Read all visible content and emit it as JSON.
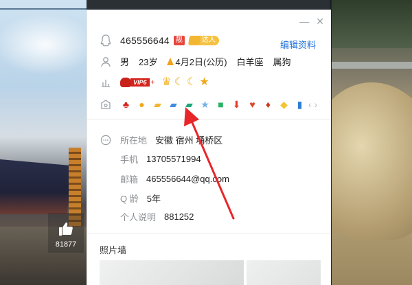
{
  "profile": {
    "qq_number": "465556644",
    "liang_badge": "靓",
    "daren_badge": "达人",
    "edit_link": "编辑资料",
    "gender": "男",
    "age": "23岁",
    "birthday": "4月2日(公历)",
    "constellation": "白羊座",
    "zodiac": "属狗",
    "vip_label": "VIP6",
    "level_icons": [
      "crown-icon",
      "moon-icon",
      "moon-icon",
      "star-icon"
    ]
  },
  "medals": [
    {
      "icon": "penguin-medal-icon",
      "color": "#d3231b"
    },
    {
      "icon": "qq-show-medal-icon",
      "color": "#f0a81a"
    },
    {
      "icon": "chat-medal-icon",
      "color": "#f2b632"
    },
    {
      "icon": "blue-chat-medal-icon",
      "color": "#3f8ee0"
    },
    {
      "icon": "green-chat-medal-icon",
      "color": "#1ea57a"
    },
    {
      "icon": "star-medal-icon",
      "color": "#6fb2e6"
    },
    {
      "icon": "gift-medal-icon",
      "color": "#28b463"
    },
    {
      "icon": "down-arrow-medal-icon",
      "color": "#e23b2f"
    },
    {
      "icon": "heart-medal-icon",
      "color": "#e0452b"
    },
    {
      "icon": "flame-medal-icon",
      "color": "#c93a1e"
    },
    {
      "icon": "diamond-medal-icon",
      "color": "#f2c531"
    },
    {
      "icon": "phone-medal-icon",
      "color": "#2f7fd8"
    }
  ],
  "details": {
    "location_label": "所在地",
    "location_value": "安徽 宿州 埇桥区",
    "phone_label": "手机",
    "phone_value": "13705571994",
    "email_label": "邮箱",
    "email_value": "465556644@qq.com",
    "qage_label": "Q 龄",
    "qage_value": "5年",
    "signature_label": "个人说明",
    "signature_value": "881252"
  },
  "photo_wall": {
    "title": "照片墙"
  },
  "like": {
    "count": "81877"
  },
  "colors": {
    "link": "#1e6fd9",
    "annotation": "#e8262a"
  }
}
